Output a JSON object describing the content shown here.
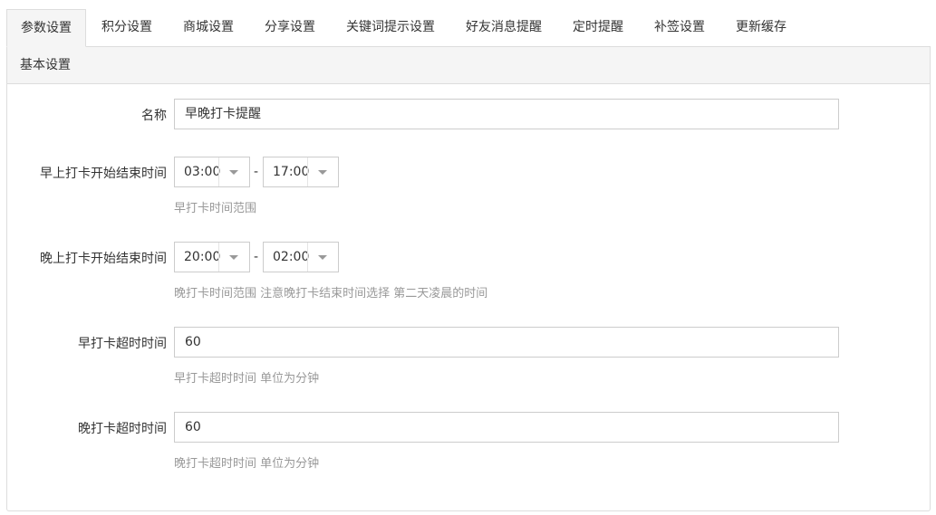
{
  "tabs": [
    {
      "label": "参数设置",
      "active": true
    },
    {
      "label": "积分设置"
    },
    {
      "label": "商城设置"
    },
    {
      "label": "分享设置"
    },
    {
      "label": "关键词提示设置"
    },
    {
      "label": "好友消息提醒"
    },
    {
      "label": "定时提醒"
    },
    {
      "label": "补签设置"
    },
    {
      "label": "更新缓存"
    }
  ],
  "panel": {
    "title": "基本设置"
  },
  "form": {
    "name": {
      "label": "名称",
      "value": "早晚打卡提醒"
    },
    "morning": {
      "label": "早上打卡开始结束时间",
      "start": "03:00",
      "separator": "-",
      "end": "17:00",
      "help": "早打卡时间范围"
    },
    "evening": {
      "label": "晚上打卡开始结束时间",
      "start": "20:00",
      "separator": "-",
      "end": "02:00",
      "help": "晚打卡时间范围 注意晚打卡结束时间选择 第二天凌晨的时间"
    },
    "morning_timeout": {
      "label": "早打卡超时时间",
      "value": "60",
      "help": "早打卡超时时间 单位为分钟"
    },
    "evening_timeout": {
      "label": "晚打卡超时时间",
      "value": "60",
      "help": "晚打卡超时时间 单位为分钟"
    }
  }
}
